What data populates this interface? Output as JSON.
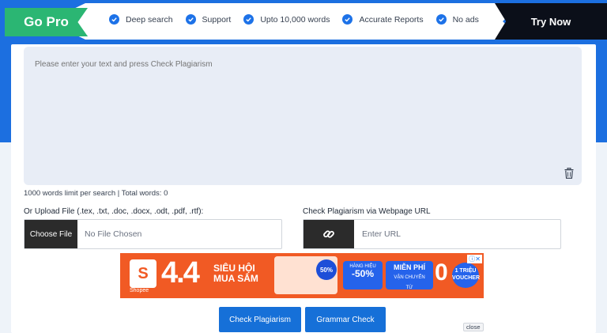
{
  "promo": {
    "go_pro_label": "Go Pro",
    "try_now_label": "Try Now",
    "features": [
      "Deep search",
      "Support",
      "Upto 10,000 words",
      "Accurate Reports",
      "No ads"
    ]
  },
  "editor": {
    "placeholder": "Please enter your text and press Check Plagiarism",
    "limit_text": "1000 words limit per search | Total words: 0"
  },
  "upload": {
    "label": "Or Upload File (.tex, .txt, .doc, .docx, .odt, .pdf, .rtf):",
    "choose_file_label": "Choose File",
    "file_status": "No File Chosen"
  },
  "url_check": {
    "label": "Check Plagiarism via Webpage URL",
    "placeholder": "Enter URL"
  },
  "ad": {
    "brand": "Shopee",
    "headline": "4.4",
    "title_line1": "SIÊU HỘI",
    "title_line2": "MUA SẮM",
    "badge_50": "50%",
    "hang_hieu_line1": "HÀNG HIỆU",
    "hang_hieu_value": "-50%",
    "mien_phi_line1": "MIỄN PHÍ",
    "mien_phi_line2": "VẬN CHUYỂN",
    "mien_phi_line3": "TỪ",
    "zero": "0",
    "trieu_line1": "1 TRIỆU",
    "trieu_line2": "VOUCHER",
    "ad_close_label": "ⓘ✕"
  },
  "actions": {
    "check_plagiarism_label": "Check Plagiarism",
    "grammar_check_label": "Grammar Check",
    "close_label": "close"
  },
  "colors": {
    "brand_blue": "#1670d8",
    "go_pro_green": "#2bb673",
    "try_now_black": "#0b0f19"
  }
}
